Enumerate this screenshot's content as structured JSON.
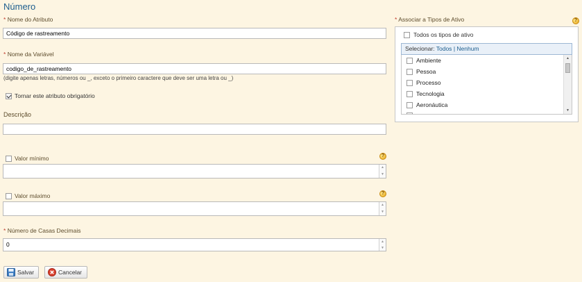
{
  "page": {
    "title": "Número"
  },
  "form": {
    "attribute_name": {
      "required_mark": "*",
      "label": "Nome do Atributo",
      "value": "Código de rastreamento"
    },
    "variable_name": {
      "required_mark": "*",
      "label": "Nome da Variável",
      "value": "codigo_de_rastreamento",
      "hint": "(digite apenas letras, números ou _, exceto o primeiro caractere que deve ser uma letra ou _)"
    },
    "mandatory": {
      "label": "Tornar este atributo obrigatório",
      "checked": true
    },
    "description": {
      "label": "Descrição",
      "value": ""
    },
    "min_value": {
      "label": "Valor mínimo",
      "checked": false,
      "value": ""
    },
    "max_value": {
      "label": "Valor máximo",
      "checked": false,
      "value": ""
    },
    "decimals": {
      "required_mark": "*",
      "label": "Número de Casas Decimais",
      "value": "0"
    }
  },
  "buttons": {
    "save": "Salvar",
    "cancel": "Cancelar"
  },
  "asset_types": {
    "required_mark": "*",
    "label": "Associar a Tipos de Ativo",
    "all_label": "Todos os tipos de ativo",
    "select_prefix": "Selecionar:",
    "select_all": "Todos",
    "separator": "|",
    "select_none": "Nenhum",
    "items": [
      "Ambiente",
      "Pessoa",
      "Processo",
      "Tecnologia",
      "Aeronáutica"
    ]
  },
  "icons": {
    "help": "question-mark-icon",
    "save": "floppy-disk-icon",
    "cancel": "cancel-circle-icon"
  },
  "colors": {
    "background": "#fdf5e2",
    "title": "#1c5d8e",
    "required": "#c0392b",
    "link": "#1c5d8e"
  }
}
